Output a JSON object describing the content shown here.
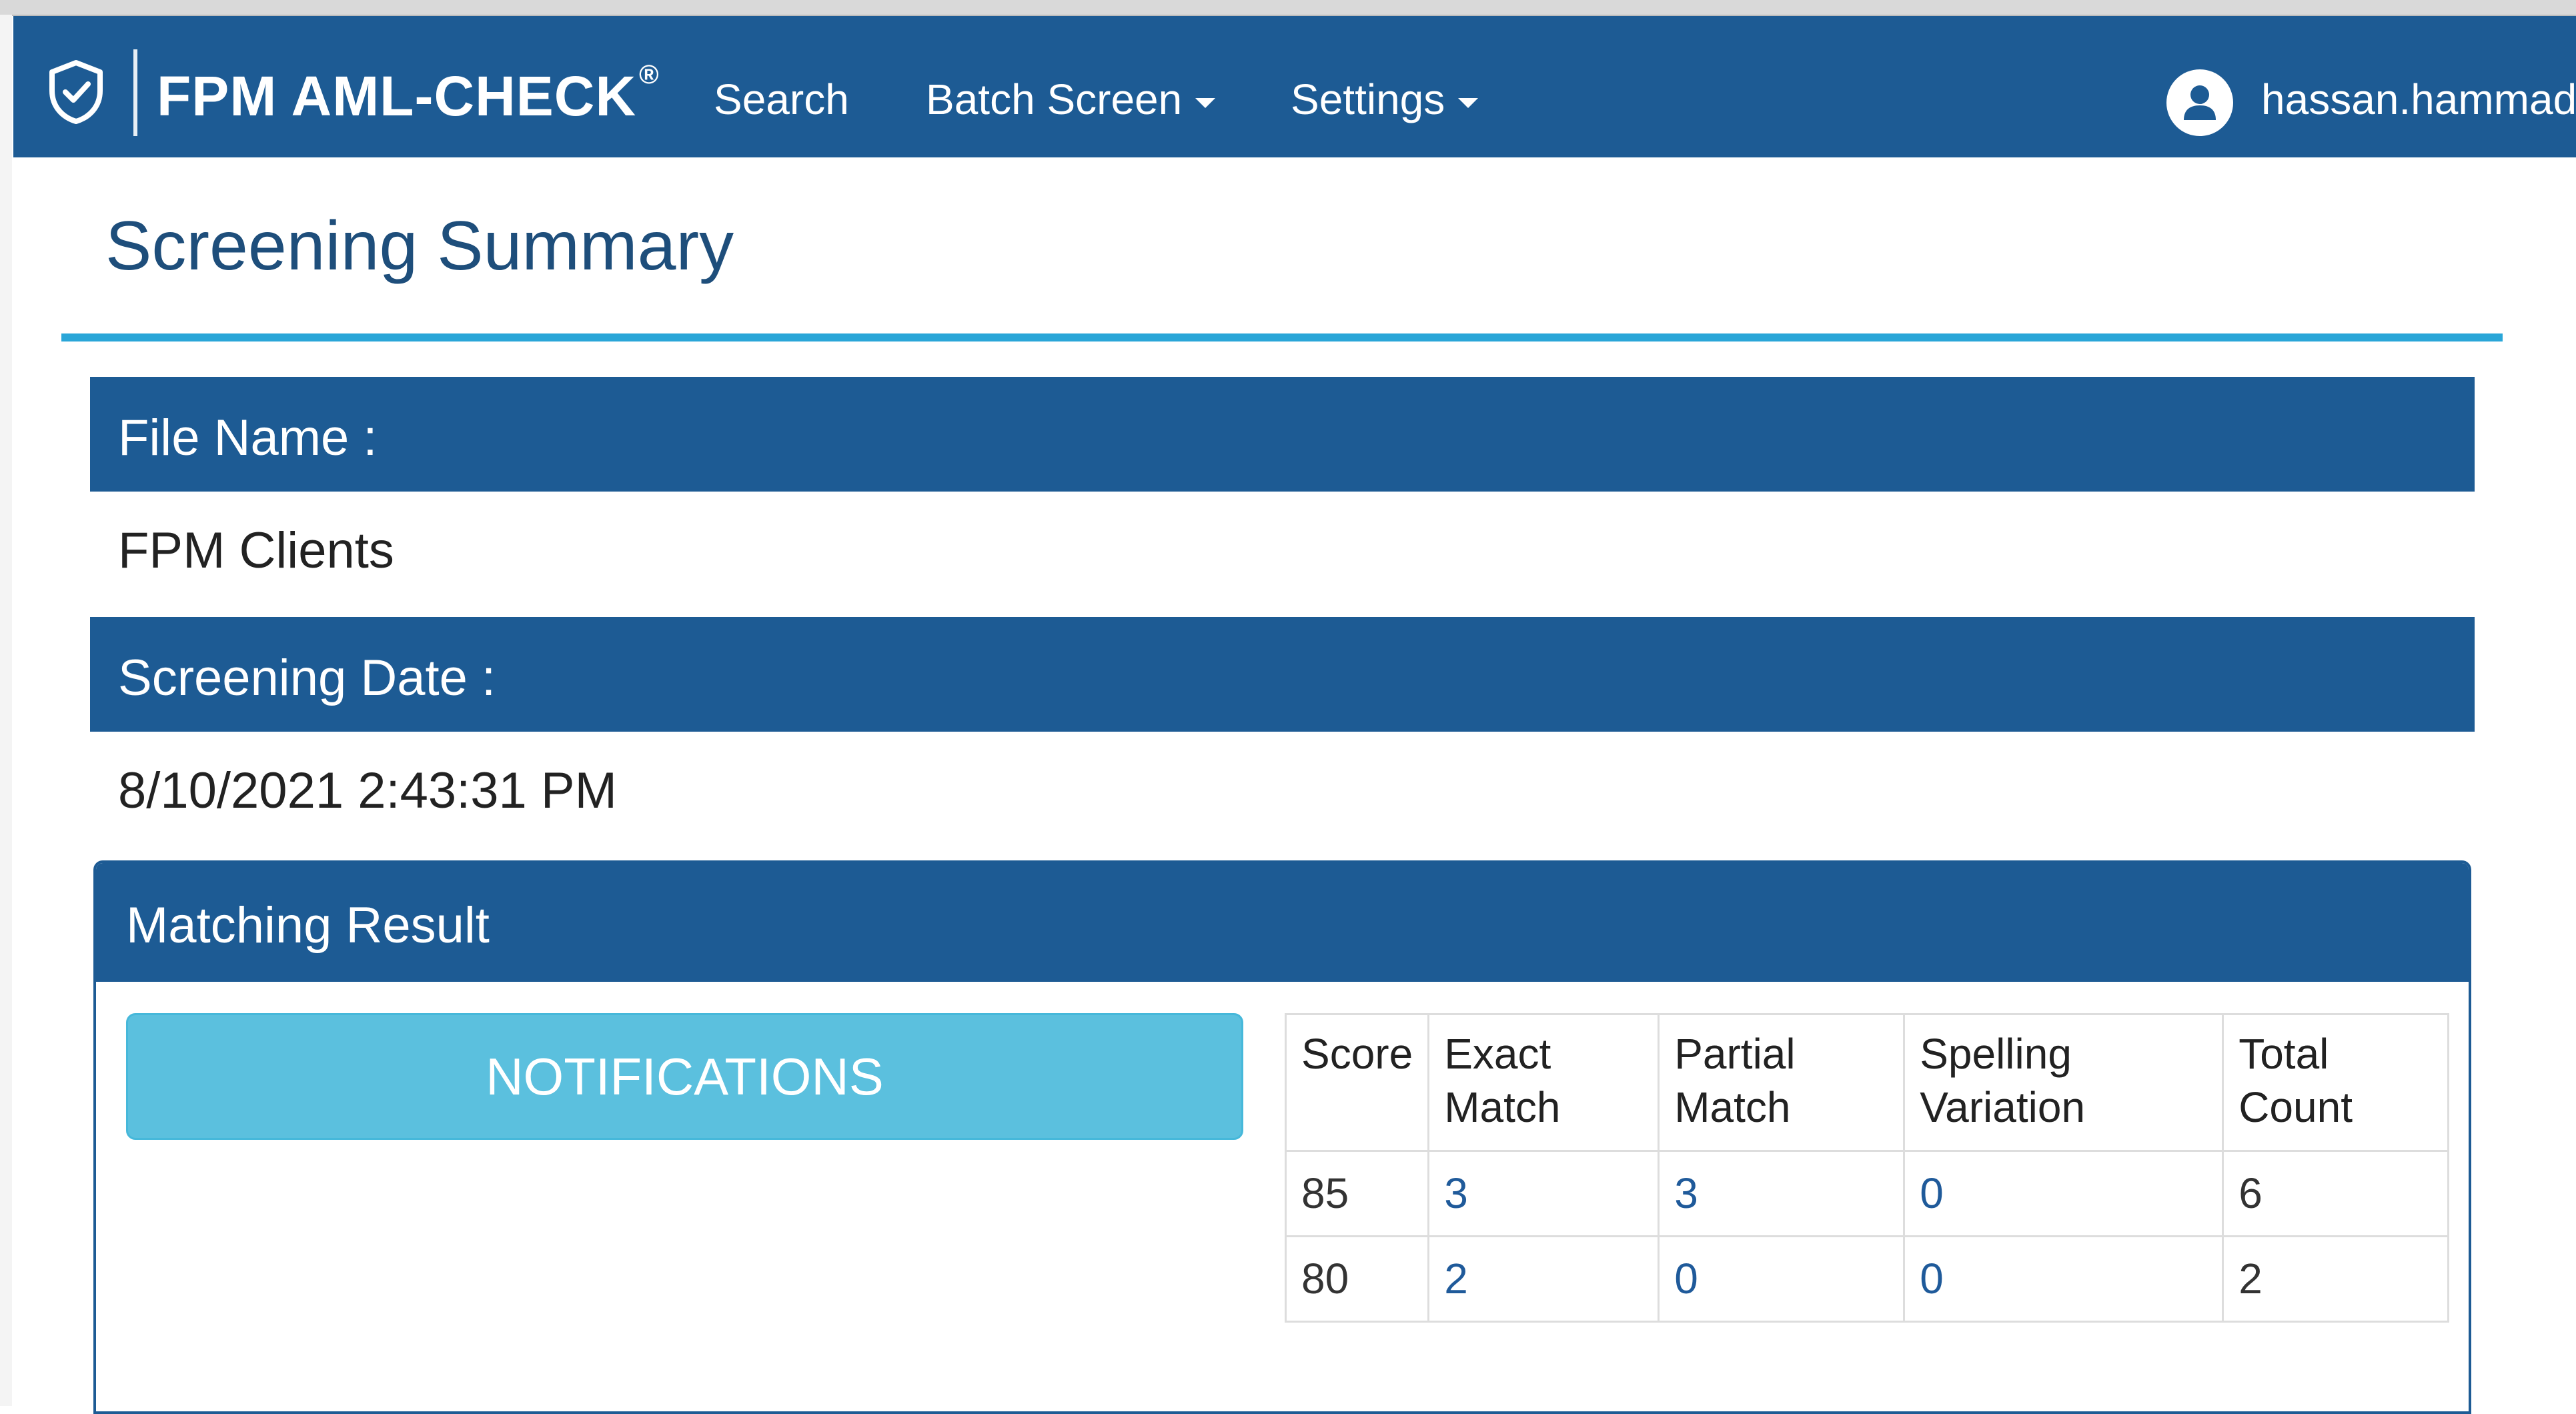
{
  "navbar": {
    "brand": "FPM AML-CHECK",
    "brand_mark": "®",
    "brand_icon": "shield-check-icon",
    "items": [
      {
        "label": "Search"
      },
      {
        "label": "Batch Screen"
      },
      {
        "label": "Settings"
      }
    ],
    "user": {
      "name": "hassan.hammad",
      "icon": "user-icon"
    },
    "color": "#1d5b94"
  },
  "page": {
    "title": "Screening Summary",
    "accent": "#2aa6d8"
  },
  "file_name": {
    "label": "File Name :",
    "value": "FPM Clients"
  },
  "screening_date": {
    "label": "Screening Date :",
    "value": "8/10/2021 2:43:31 PM"
  },
  "matching_result": {
    "title": "Matching Result",
    "notifications_label": "NOTIFICATIONS",
    "notifications_color": "#5bc0de",
    "table": {
      "headers": [
        "Score",
        "Exact Match",
        "Partial Match",
        "Spelling Variation",
        "Total Count"
      ],
      "rows": [
        {
          "score": "85",
          "exact": "3",
          "partial": "3",
          "spelling": "0",
          "total": "6"
        },
        {
          "score": "80",
          "exact": "2",
          "partial": "0",
          "spelling": "0",
          "total": "2"
        }
      ]
    }
  }
}
